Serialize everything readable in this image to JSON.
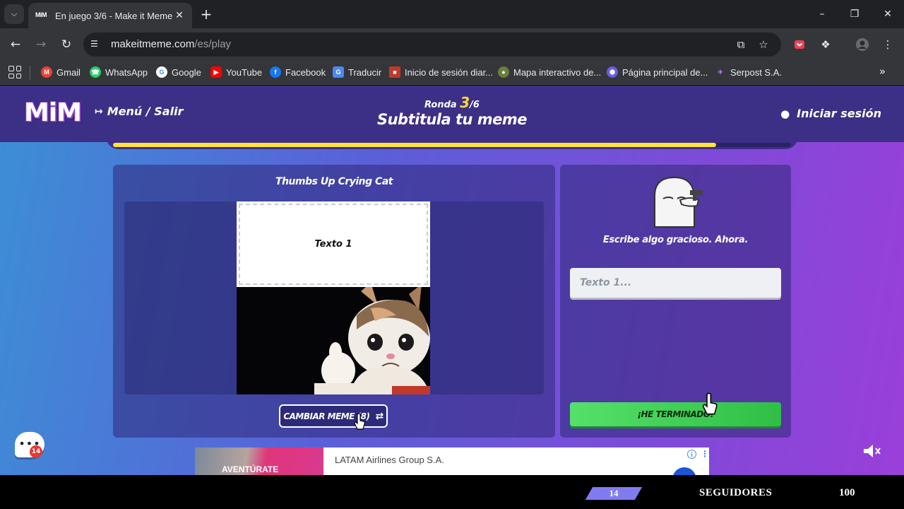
{
  "browser": {
    "tab": {
      "favicon_text": "MiM",
      "title": "En juego 3/6 - Make it Meme"
    },
    "address_bar": {
      "host": "makeitmeme.com",
      "path": "/es/play"
    },
    "bookmarks": [
      {
        "label": "Gmail",
        "icon": "gmail-icon",
        "color": "#ea4335"
      },
      {
        "label": "WhatsApp",
        "icon": "whatsapp-icon",
        "color": "#25d366"
      },
      {
        "label": "Google",
        "icon": "google-icon",
        "color": "#4285f4"
      },
      {
        "label": "YouTube",
        "icon": "youtube-icon",
        "color": "#ff0000"
      },
      {
        "label": "Facebook",
        "icon": "facebook-icon",
        "color": "#1877f2"
      },
      {
        "label": "Traducir",
        "icon": "translate-icon",
        "color": "#4a8af4"
      },
      {
        "label": "Inicio de sesión diar...",
        "icon": "login-site-icon",
        "color": "#c0392b"
      },
      {
        "label": "Mapa interactivo de...",
        "icon": "map-site-icon",
        "color": "#6a7f3a"
      },
      {
        "label": "Página principal de...",
        "icon": "homepage-site-icon",
        "color": "#6c5ce7"
      },
      {
        "label": "Serpost S.A.",
        "icon": "serpost-icon",
        "color": "#7b2ff7"
      }
    ]
  },
  "game": {
    "logo": "MiM",
    "menu_label": "Menú / Salir",
    "round_label": "Ronda",
    "round_current": "3",
    "round_total": "/6",
    "title": "Subtitula tu meme",
    "login_label": "Iniciar sesión",
    "progress_fraction": 0.89,
    "accent_color": "#ffe33a",
    "meme": {
      "name": "Thumbs Up Crying Cat",
      "text_box_label": "Texto 1",
      "change_button_label": "CAMBIAR MEME (8)"
    },
    "prompt": "Escribe algo gracioso. Ahora.",
    "input": {
      "placeholder": "Texto 1...",
      "value": ""
    },
    "done_button_label": "¡HE TERMINADO!",
    "chat_badge_count": "14"
  },
  "ad": {
    "cta": "AVENTÚRATE",
    "brand": "LATAM Airlines Group S.A."
  },
  "overlay": {
    "count": "14",
    "label": "SEGUIDORES",
    "goal": "100"
  }
}
